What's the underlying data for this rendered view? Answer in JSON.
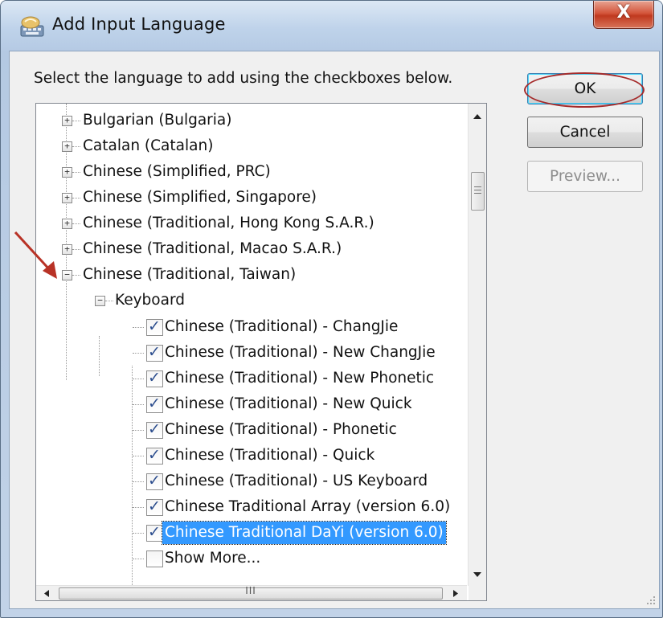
{
  "window": {
    "title": "Add Input Language",
    "close_glyph": "X"
  },
  "instruction": "Select the language to add using the checkboxes below.",
  "tree": {
    "languages": [
      {
        "label": "Bulgarian (Bulgaria)",
        "expanded": false
      },
      {
        "label": "Catalan (Catalan)",
        "expanded": false
      },
      {
        "label": "Chinese (Simplified, PRC)",
        "expanded": false
      },
      {
        "label": "Chinese (Simplified, Singapore)",
        "expanded": false
      },
      {
        "label": "Chinese (Traditional, Hong Kong S.A.R.)",
        "expanded": false
      },
      {
        "label": "Chinese (Traditional, Macao S.A.R.)",
        "expanded": false
      },
      {
        "label": "Chinese (Traditional, Taiwan)",
        "expanded": true
      }
    ],
    "group_label": "Keyboard",
    "keyboards": [
      {
        "label": "Chinese (Traditional) - ChangJie",
        "checked": true
      },
      {
        "label": "Chinese (Traditional) - New ChangJie",
        "checked": true
      },
      {
        "label": "Chinese (Traditional) - New Phonetic",
        "checked": true
      },
      {
        "label": "Chinese (Traditional) - New Quick",
        "checked": true
      },
      {
        "label": "Chinese (Traditional) - Phonetic",
        "checked": true
      },
      {
        "label": "Chinese (Traditional) - Quick",
        "checked": true
      },
      {
        "label": "Chinese (Traditional) - US Keyboard",
        "checked": true
      },
      {
        "label": "Chinese Traditional Array (version 6.0)",
        "checked": true
      },
      {
        "label": "Chinese Traditional DaYi (version 6.0)",
        "checked": true,
        "selected": true
      }
    ],
    "show_more": {
      "label": "Show More...",
      "checked": false
    },
    "hscroll_grip": "III"
  },
  "buttons": {
    "ok": "OK",
    "cancel": "Cancel",
    "preview": "Preview..."
  },
  "colors": {
    "annotation": "#a52a2a",
    "selection": "#3399ff",
    "check": "#2e4f8f"
  },
  "icons": {
    "title": "input-language-icon",
    "collapsed": "plus-box-icon",
    "expanded": "minus-box-icon",
    "annotation": "red-arrow-icon"
  }
}
